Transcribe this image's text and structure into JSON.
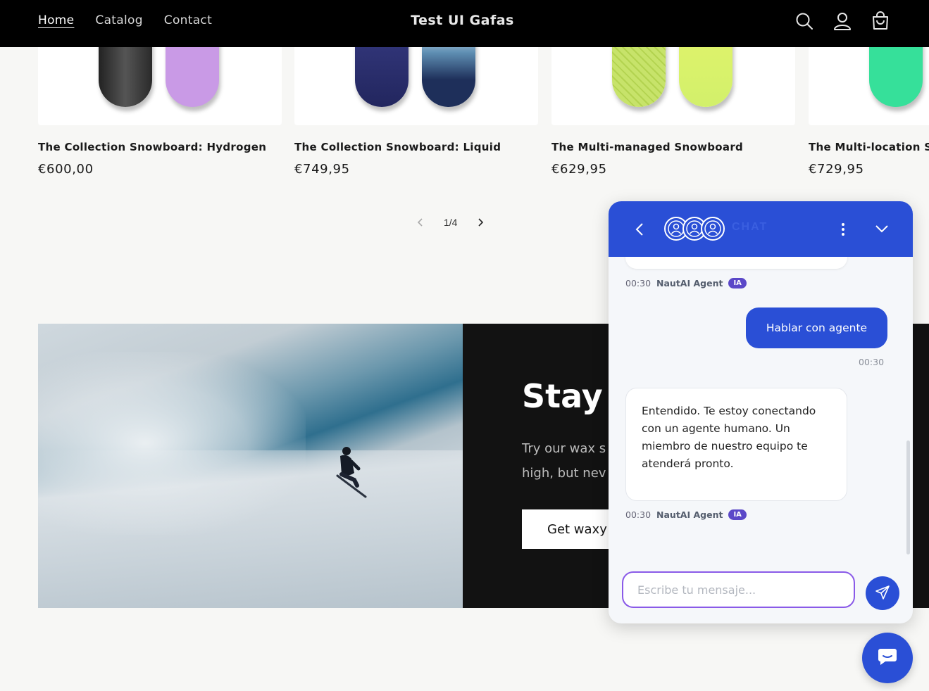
{
  "header": {
    "nav": [
      {
        "label": "Home",
        "active": true
      },
      {
        "label": "Catalog",
        "active": false
      },
      {
        "label": "Contact",
        "active": false
      }
    ],
    "brand": "Test UI Gafas",
    "icons": [
      "search-icon",
      "account-icon",
      "cart-icon"
    ]
  },
  "products": [
    {
      "title": "The Collection Snowboard: Hydrogen",
      "price": "€600,00"
    },
    {
      "title": "The Collection Snowboard: Liquid",
      "price": "€749,95"
    },
    {
      "title": "The Multi-managed Snowboard",
      "price": "€629,95"
    },
    {
      "title": "The Multi-location Snowboard",
      "price": "€729,95"
    }
  ],
  "pager": {
    "label": "1/4"
  },
  "banner": {
    "heading": "Stay h",
    "copy_line1": "Try our wax s",
    "copy_line2": "high, but nev",
    "cta": "Get waxy"
  },
  "chat": {
    "header_title": "CHAT",
    "messages": {
      "agent_meta_1": {
        "time": "00:30",
        "agent": "NautAI Agent",
        "badge": "IA"
      },
      "user_message": "Hablar con agente",
      "user_time": "00:30",
      "agent_message": "Entendido. Te estoy conectando con un agente humano. Un miembro de nuestro equipo te atenderá pronto.",
      "agent_meta_2": {
        "time": "00:30",
        "agent": "NautAI Agent",
        "badge": "IA"
      }
    },
    "input_placeholder": "Escribe tu mensaje...",
    "colors": {
      "primary": "#2a4fd6",
      "badge": "#5b48c8",
      "input_border": "#8a5ae8"
    }
  }
}
